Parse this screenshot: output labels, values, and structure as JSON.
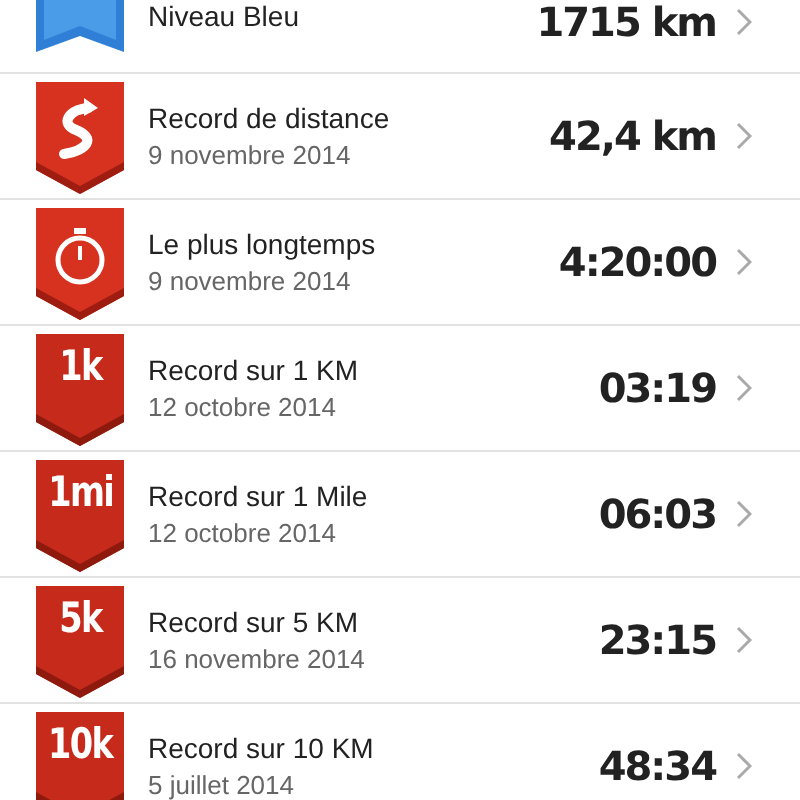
{
  "records": [
    {
      "kind": "level",
      "title": "Niveau Bleu",
      "value": "1715 km"
    },
    {
      "kind": "distance",
      "title": "Record de distance",
      "date": "9 novembre 2014",
      "value": "42,4 km"
    },
    {
      "kind": "duration",
      "title": "Le plus longtemps",
      "date": "9 novembre 2014",
      "value": "4:20:00"
    },
    {
      "kind": "label",
      "badge": "1k",
      "title": "Record sur 1 KM",
      "date": "12 octobre 2014",
      "value": "03:19"
    },
    {
      "kind": "label",
      "badge": "1mi",
      "title": "Record sur 1 Mile",
      "date": "12 octobre 2014",
      "value": "06:03"
    },
    {
      "kind": "label",
      "badge": "5k",
      "title": "Record sur 5 KM",
      "date": "16 novembre 2014",
      "value": "23:15"
    },
    {
      "kind": "label",
      "badge": "10k",
      "title": "Record sur 10 KM",
      "date": "5 juillet 2014",
      "value": "48:34"
    }
  ]
}
